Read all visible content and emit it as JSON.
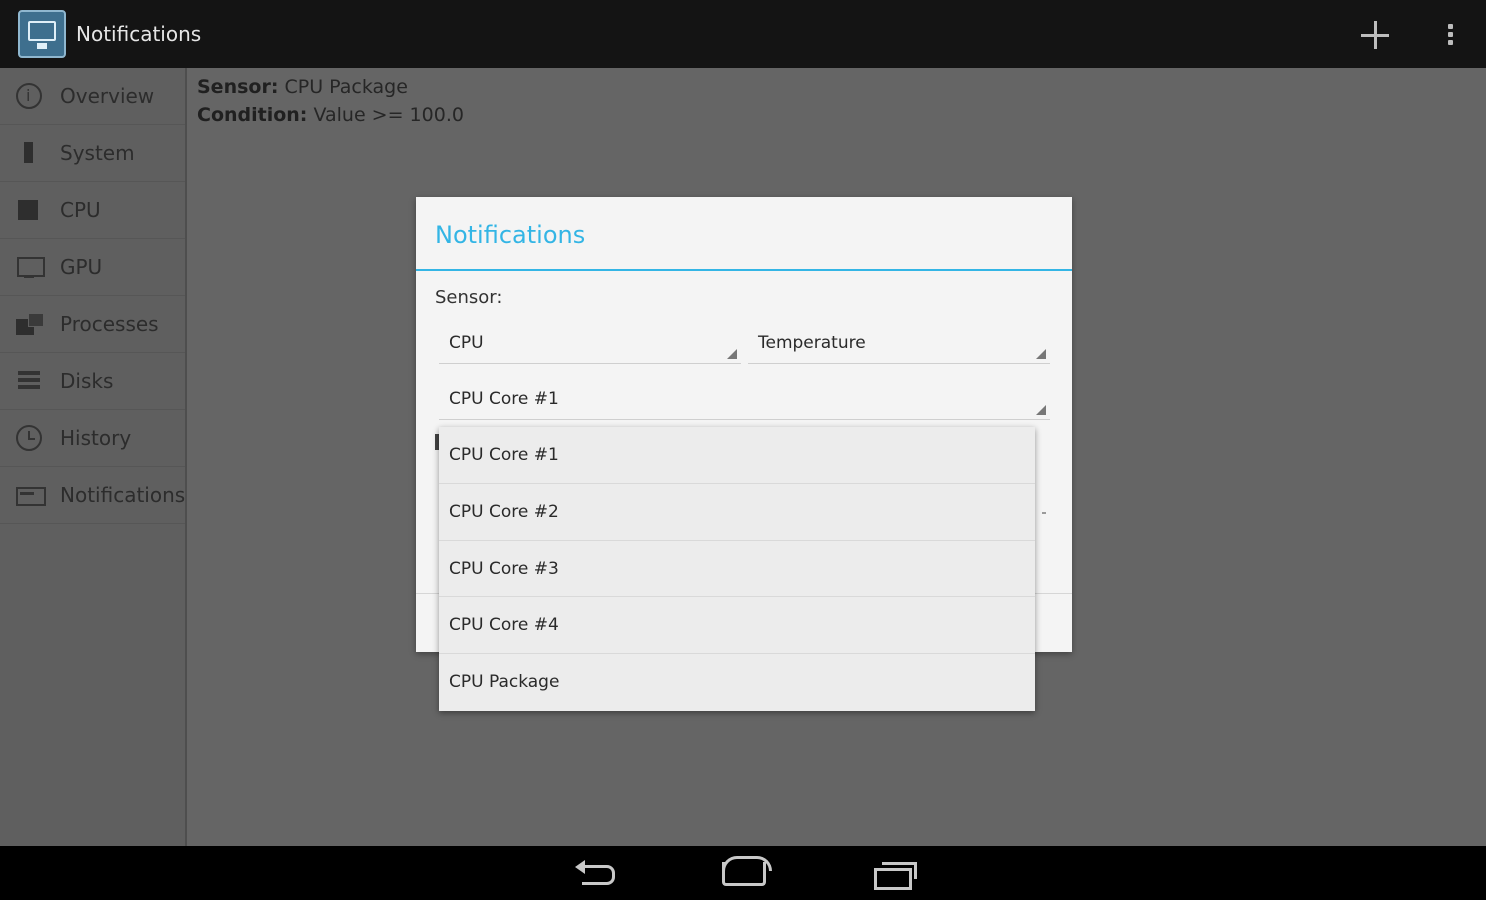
{
  "actionbar": {
    "title": "Notifications",
    "app_icon": "monitor-app-icon",
    "add_icon": "plus-icon",
    "menu_icon": "overflow-menu-icon"
  },
  "sidebar": {
    "items": [
      {
        "label": "Overview",
        "icon": "info-icon"
      },
      {
        "label": "System",
        "icon": "system-icon"
      },
      {
        "label": "CPU",
        "icon": "cpu-icon"
      },
      {
        "label": "GPU",
        "icon": "monitor-icon"
      },
      {
        "label": "Processes",
        "icon": "processes-icon"
      },
      {
        "label": "Disks",
        "icon": "disks-icon"
      },
      {
        "label": "History",
        "icon": "clock-icon"
      },
      {
        "label": "Notifications",
        "icon": "notification-icon"
      }
    ]
  },
  "main": {
    "sensor_key": "Sensor:",
    "sensor_value": " CPU Package",
    "condition_key": "Condition:",
    "condition_value": " Value >= 100.0"
  },
  "dialog": {
    "title": "Notifications",
    "sensor_label": "Sensor:",
    "category_value": "CPU",
    "type_value": "Temperature",
    "sensor_value": "CPU Core #1"
  },
  "dropdown": {
    "options": [
      "CPU Core #1",
      "CPU Core #2",
      "CPU Core #3",
      "CPU Core #4",
      "CPU Package"
    ]
  },
  "colors": {
    "accent": "#33b5e5",
    "actionbar": "#141414",
    "background": "#656565"
  },
  "navbar": {
    "back_icon": "back-icon",
    "home_icon": "home-icon",
    "recents_icon": "recents-icon"
  }
}
